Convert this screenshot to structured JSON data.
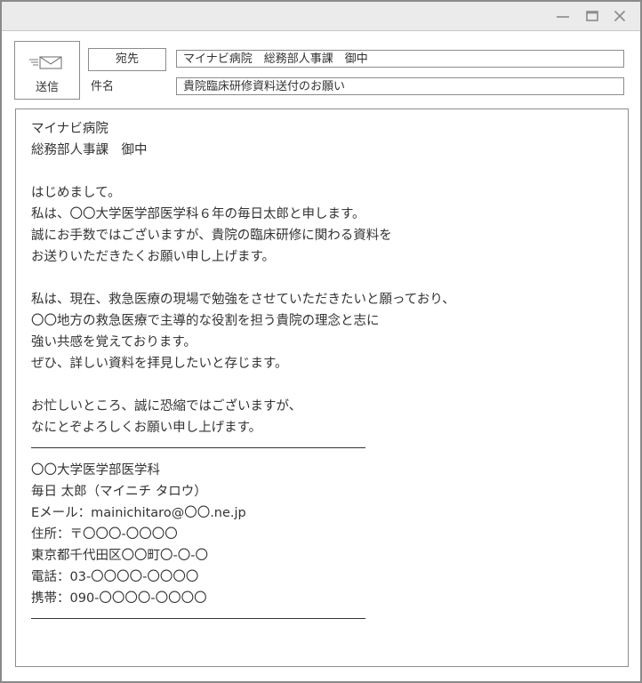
{
  "window": {
    "controls": {
      "minimize_icon": "minimize-icon",
      "maximize_icon": "maximize-icon",
      "close_icon": "close-icon"
    }
  },
  "toolbar": {
    "send_label": "送信",
    "send_icon": "envelope-icon"
  },
  "header": {
    "to_label": "宛先",
    "to_value": "マイナビ病院　総務部人事課　御中",
    "subject_label": "件名",
    "subject_value": "貴院臨床研修資料送付のお願い"
  },
  "body": {
    "addressee": [
      "マイナビ病院",
      "総務部人事課　御中"
    ],
    "paragraph1": [
      "はじめまして。",
      "私は、〇〇大学医学部医学科６年の毎日太郎と申します。",
      "誠にお手数ではございますが、貴院の臨床研修に関わる資料を",
      "お送りいただきたくお願い申し上げます。"
    ],
    "paragraph2": [
      "私は、現在、救急医療の現場で勉強をさせていただきたいと願っており、",
      "〇〇地方の救急医療で主導的な役割を担う貴院の理念と志に",
      "強い共感を覚えております。",
      "ぜひ、詳しい資料を拝見したいと存じます。"
    ],
    "paragraph3": [
      "お忙しいところ、誠に恐縮ではございますが、",
      "なにとぞよろしくお願い申し上げます。"
    ],
    "signature": [
      "〇〇大学医学部医学科",
      "毎日 太郎（マイニチ タロウ）",
      "Eメール：mainichitaro@〇〇.ne.jp",
      "住所：〒〇〇〇-〇〇〇〇",
      "東京都千代田区〇〇町〇-〇-〇",
      "電話：03-〇〇〇〇-〇〇〇〇",
      "携帯：090-〇〇〇〇-〇〇〇〇"
    ]
  }
}
